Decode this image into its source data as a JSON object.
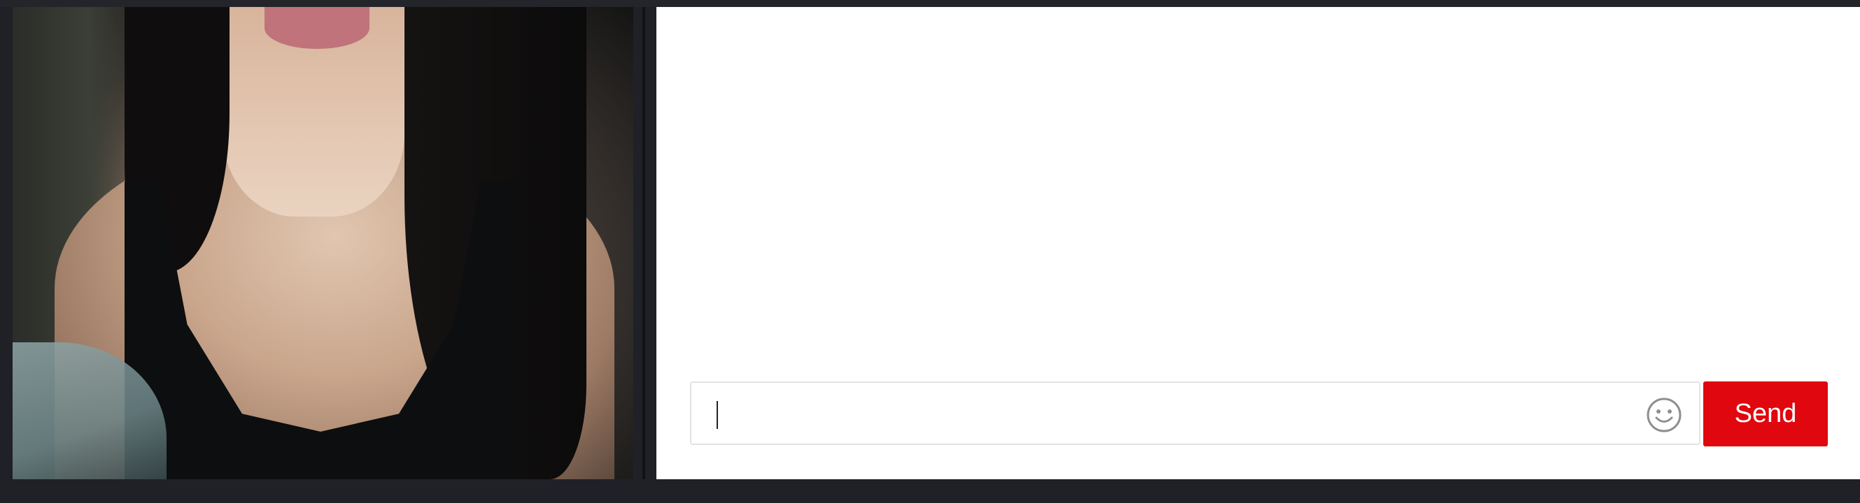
{
  "video": {
    "label": ""
  },
  "chat": {
    "messages": [],
    "input": {
      "value": "",
      "placeholder": ""
    },
    "emoji_icon": "smiley-face-icon",
    "send_label": "Send",
    "send_color": "#e0070f"
  },
  "theme": {
    "background": "#1f2127",
    "chat_background": "#ffffff",
    "input_border": "#e3e3e3"
  }
}
